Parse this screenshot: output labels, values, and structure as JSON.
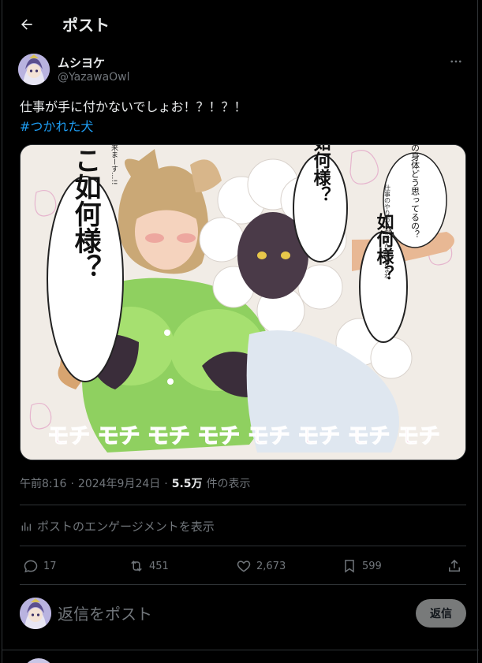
{
  "header": {
    "title": "ポスト"
  },
  "author": {
    "display_name": "ムシヨケ",
    "handle": "@YazawaOwl"
  },
  "tweet": {
    "text": "仕事が手に付かないでしょお！？！？！",
    "hashtag": "#つかれた犬"
  },
  "media": {
    "icon": "image",
    "speech_left": "ここ如何様？",
    "speech_mid": "如何様？",
    "speech_right": "如何様？",
    "side_text_top": "ねえ犬くんはその身体どう思ってるの？",
    "side_text_small": "仕事のやり方とかそんなんだよね",
    "side_text_left": "出来まーす…!!",
    "sfx": "モチ モチ モチ モチ モチ モチ モチ モチ"
  },
  "meta": {
    "time": "午前8:16",
    "sep1": "·",
    "date": "2024年9月24日",
    "sep2": "·",
    "views_count": "5.5万",
    "views_label": "件の表示"
  },
  "engagement": {
    "label": "ポストのエンゲージメントを表示"
  },
  "actions": {
    "replies": "17",
    "reposts": "451",
    "likes": "2,673",
    "bookmarks": "599"
  },
  "reply": {
    "placeholder": "返信をポスト",
    "button_label": "返信"
  },
  "colors": {
    "accent": "#1d9bf0",
    "background": "#000000",
    "muted": "#71767b",
    "divider": "#2f3336"
  }
}
